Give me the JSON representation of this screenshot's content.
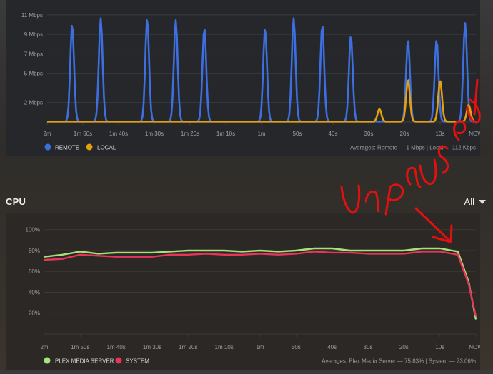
{
  "bandwidth": {
    "chart_data": {
      "type": "line",
      "x_ticks": [
        "2m",
        "1m 50s",
        "1m 40s",
        "1m 30s",
        "1m 20s",
        "1m 10s",
        "1m",
        "50s",
        "40s",
        "30s",
        "20s",
        "10s",
        "NOW"
      ],
      "y_ticks": [
        "11 Mbps",
        "9 Mbps",
        "7 Mbps",
        "5 Mbps",
        "2 Mbps"
      ],
      "y_tick_values": [
        11,
        9,
        7,
        5,
        2
      ],
      "ylim": [
        0,
        11.5
      ],
      "xlim": [
        -120,
        0
      ],
      "series": [
        {
          "name": "REMOTE",
          "color": "#3d6fe0",
          "peaks": [
            {
              "x": -113,
              "y": 10
            },
            {
              "x": -105,
              "y": 10.6
            },
            {
              "x": -92,
              "y": 10.6
            },
            {
              "x": -84,
              "y": 10.4
            },
            {
              "x": -76,
              "y": 9.6
            },
            {
              "x": -59,
              "y": 9.6
            },
            {
              "x": -51,
              "y": 10.6
            },
            {
              "x": -43,
              "y": 9.9
            },
            {
              "x": -35,
              "y": 8.8
            },
            {
              "x": -19,
              "y": 8.4
            },
            {
              "x": -11,
              "y": 8.4
            },
            {
              "x": -3,
              "y": 10.1
            }
          ]
        },
        {
          "name": "LOCAL",
          "color": "#e5a00d",
          "peaks": [
            {
              "x": -27,
              "y": 1.3
            },
            {
              "x": -19,
              "y": 4.3
            },
            {
              "x": -10,
              "y": 4.2
            },
            {
              "x": -2,
              "y": 1.7
            }
          ]
        }
      ]
    },
    "legend": [
      {
        "label": "REMOTE",
        "color": "#3d6fe0"
      },
      {
        "label": "LOCAL",
        "color": "#e5a00d"
      }
    ],
    "averages": "Averages: Remote — 1 Mbps | Local — 112 Kbps"
  },
  "cpu": {
    "title": "CPU",
    "filter_value": "All",
    "chart_data": {
      "type": "line",
      "x_ticks": [
        "2m",
        "1m 50s",
        "1m 40s",
        "1m 30s",
        "1m 20s",
        "1m 10s",
        "1m",
        "50s",
        "40s",
        "30s",
        "20s",
        "10s",
        "NOW"
      ],
      "y_ticks": [
        "100%",
        "80%",
        "60%",
        "40%",
        "20%"
      ],
      "y_tick_values": [
        100,
        80,
        60,
        40,
        20
      ],
      "ylim": [
        0,
        108
      ],
      "xlim": [
        -120,
        0
      ],
      "x": [
        -120,
        -115,
        -110,
        -105,
        -100,
        -95,
        -90,
        -85,
        -80,
        -75,
        -70,
        -65,
        -60,
        -55,
        -50,
        -45,
        -40,
        -35,
        -30,
        -25,
        -20,
        -15,
        -10,
        -5,
        -2,
        0
      ],
      "series": [
        {
          "name": "PLEX MEDIA SERVER",
          "color": "#a6e27a",
          "values": [
            74,
            76,
            79,
            77,
            78,
            78,
            78,
            79,
            80,
            80,
            80,
            79,
            80,
            79,
            80,
            82,
            82,
            80,
            80,
            80,
            80,
            82,
            82,
            79,
            50,
            14
          ]
        },
        {
          "name": "SYSTEM",
          "color": "#e8345a",
          "values": [
            71,
            72,
            76,
            75,
            74,
            74,
            74,
            76,
            76,
            77,
            76,
            76,
            77,
            76,
            77,
            79,
            78,
            78,
            77,
            77,
            77,
            79,
            79,
            76,
            48,
            17
          ]
        }
      ]
    },
    "legend": [
      {
        "label": "PLEX MEDIA SERVER",
        "color": "#a6e27a"
      },
      {
        "label": "SYSTEM",
        "color": "#e8345a"
      }
    ],
    "averages": "Averages: Plex Media Server — 75.83% | System — 73.06%"
  },
  "annotation": {
    "text": "Unpaused",
    "color": "#e31010"
  }
}
